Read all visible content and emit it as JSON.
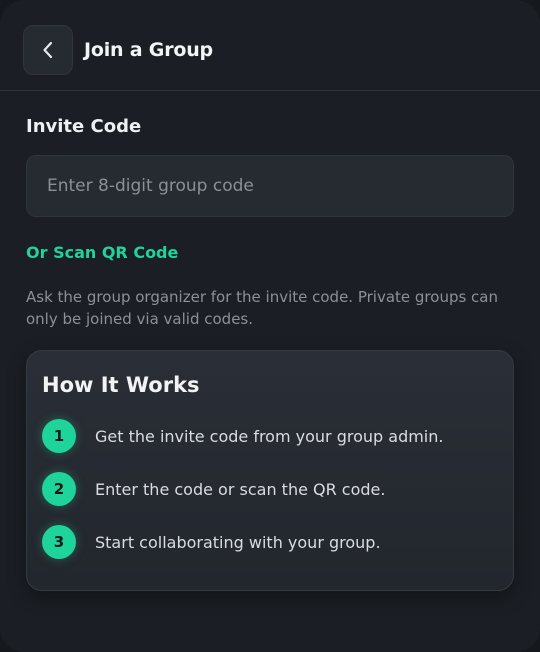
{
  "header": {
    "back_icon": "chevron-left-icon",
    "title": "Join a Group"
  },
  "form": {
    "label": "Invite Code",
    "input_value": "",
    "input_placeholder": "Enter 8-digit group code",
    "scan_link": "Or Scan QR Code",
    "help_text": "Ask the group organizer for the invite code. Private groups can only be joined via valid codes."
  },
  "how_it_works": {
    "title": "How It Works",
    "steps": [
      {
        "number": "1",
        "text": "Get the invite code from your group admin."
      },
      {
        "number": "2",
        "text": "Enter the code or scan the QR code."
      },
      {
        "number": "3",
        "text": "Start collaborating with your group."
      }
    ]
  },
  "colors": {
    "accent": "#1fd49a",
    "background": "#1b1e24",
    "surface": "#262a31"
  }
}
